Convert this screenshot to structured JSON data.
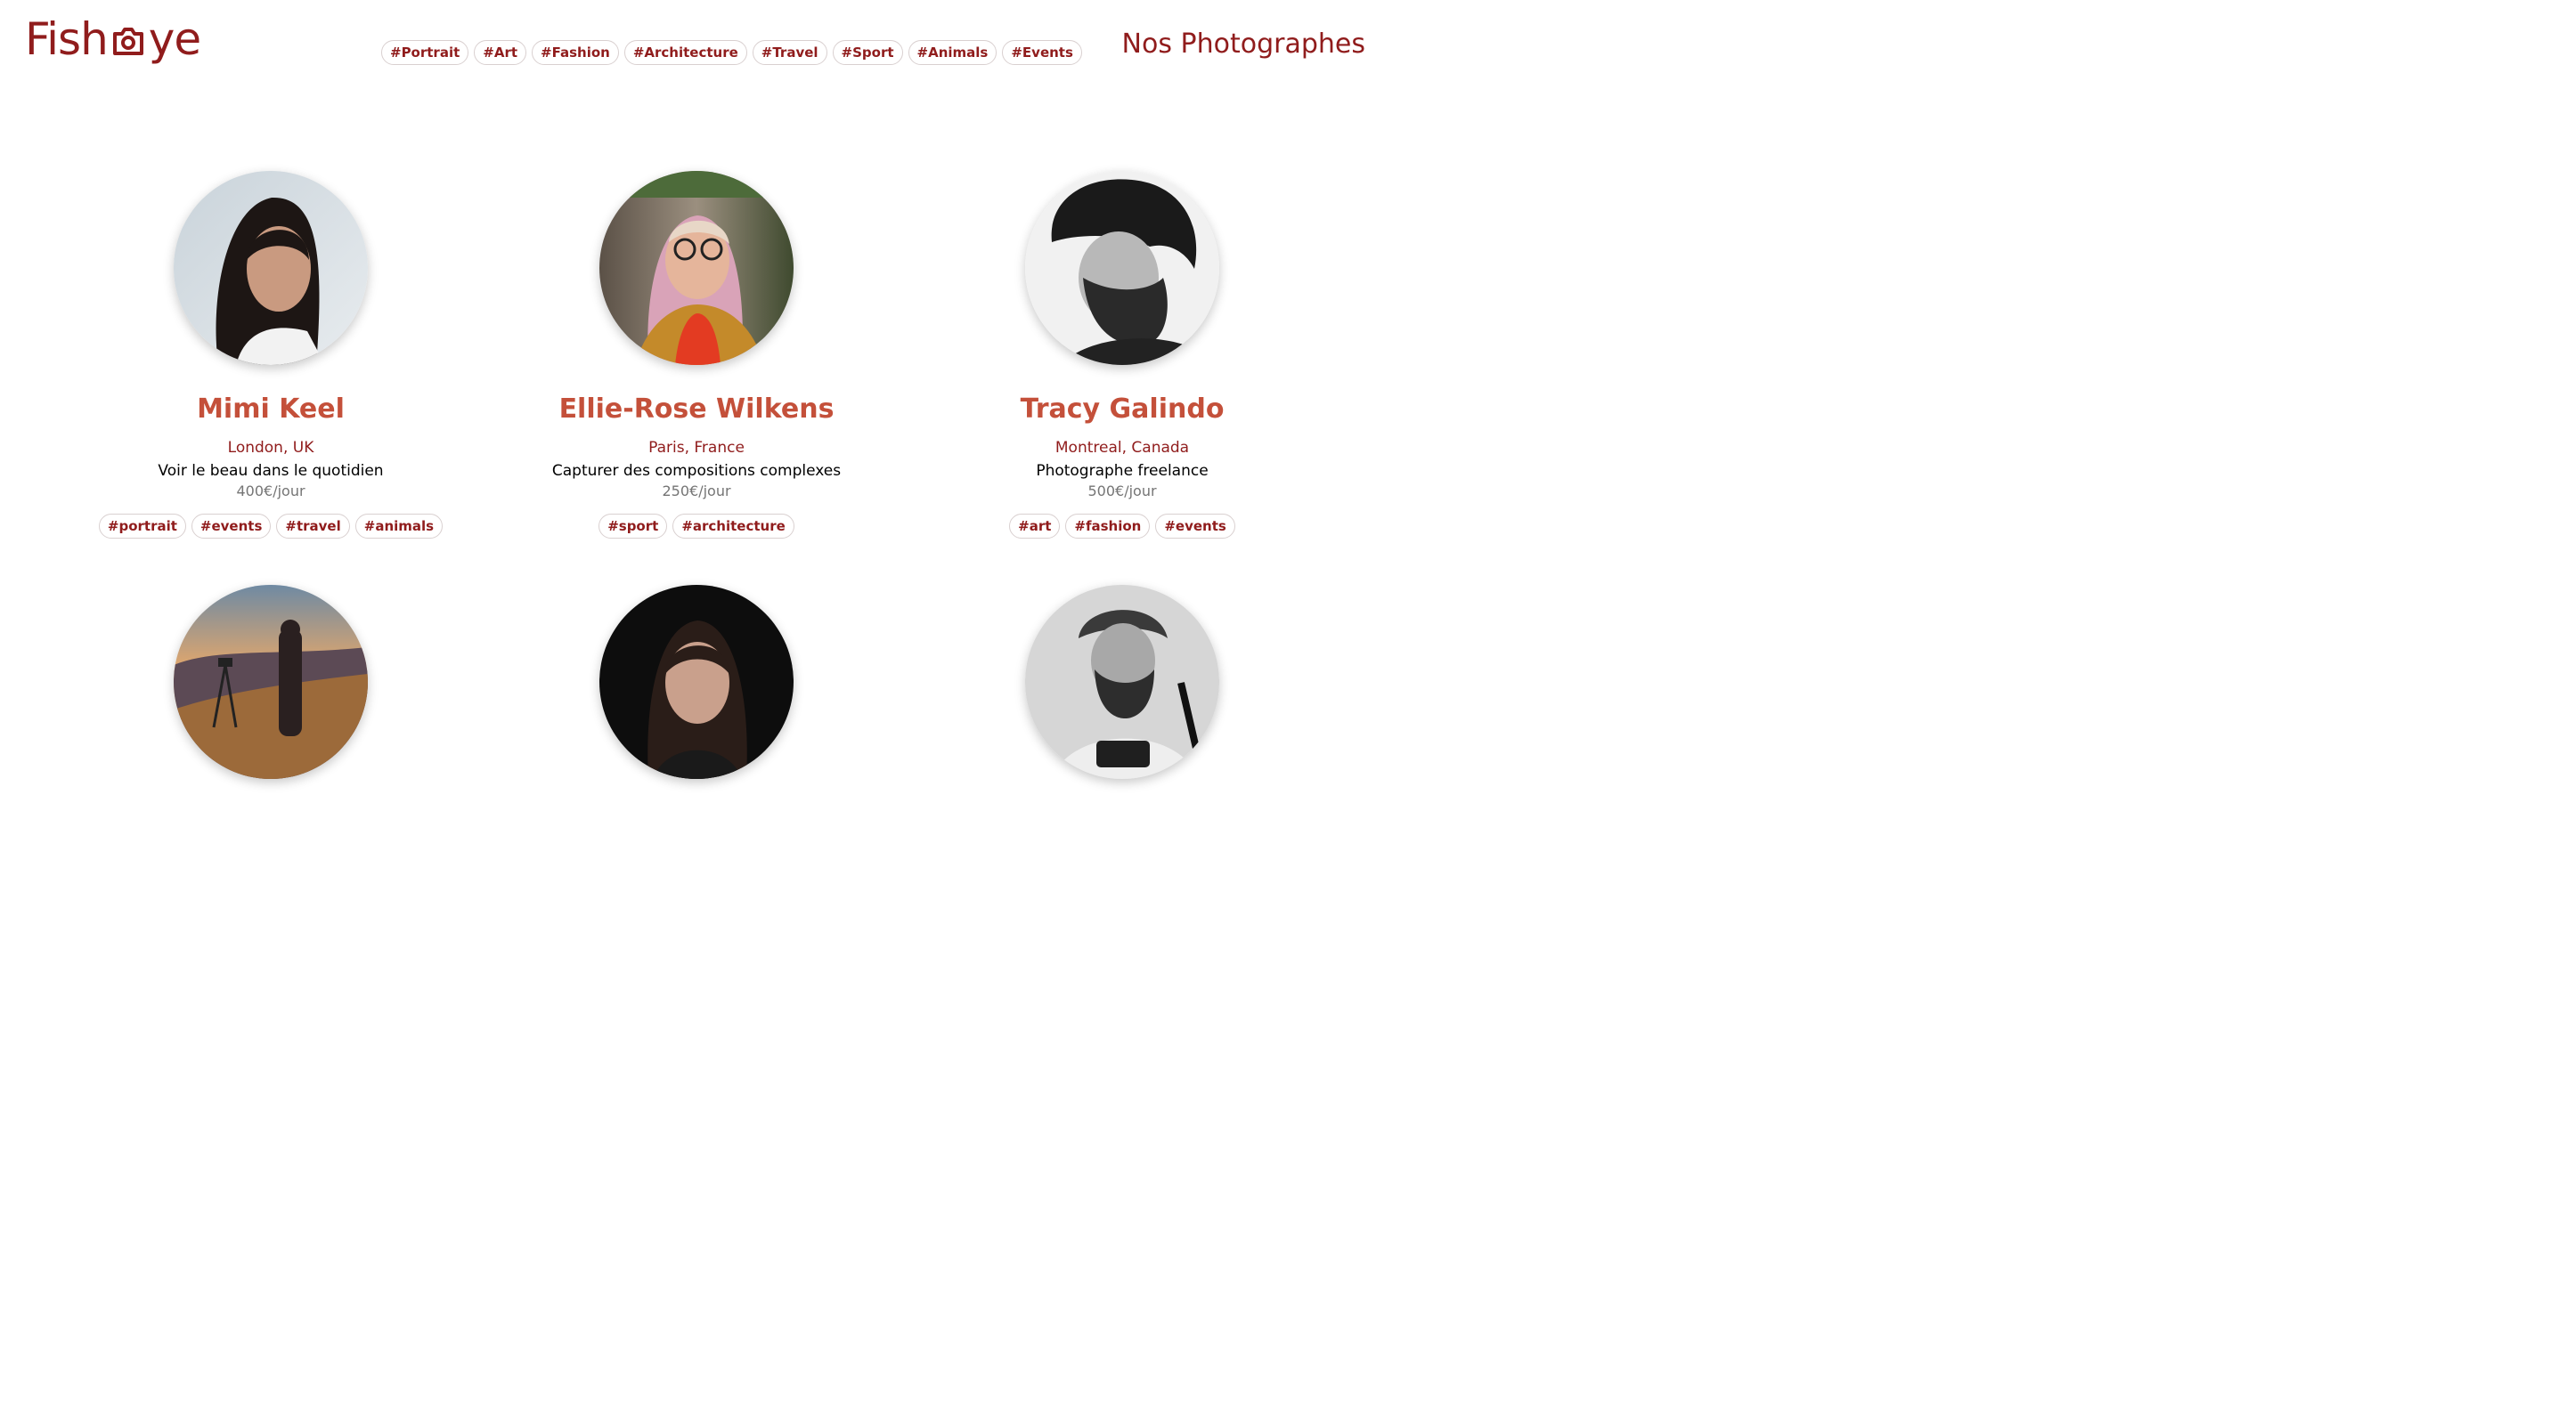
{
  "logo": {
    "text_before": "Fish",
    "text_after": "ye",
    "icon": "camera-icon",
    "color": "#901c1c"
  },
  "nav": {
    "tags": [
      "#Portrait",
      "#Art",
      "#Fashion",
      "#Architecture",
      "#Travel",
      "#Sport",
      "#Animals",
      "#Events"
    ]
  },
  "page_title": "Nos Photographes",
  "colors": {
    "primary": "#901c1c",
    "name": "#c4503a",
    "price": "#757575"
  },
  "photographers": [
    {
      "name": "Mimi Keel",
      "city": "London, UK",
      "tagline": "Voir le beau dans le quotidien",
      "price": "400€/jour",
      "tags": [
        "#portrait",
        "#events",
        "#travel",
        "#animals"
      ],
      "portrait": "portrait-photo"
    },
    {
      "name": "Ellie-Rose Wilkens",
      "city": "Paris, France",
      "tagline": "Capturer des compositions complexes",
      "price": "250€/jour",
      "tags": [
        "#sport",
        "#architecture"
      ],
      "portrait": "portrait-photo"
    },
    {
      "name": "Tracy Galindo",
      "city": "Montreal, Canada",
      "tagline": "Photographe freelance",
      "price": "500€/jour",
      "tags": [
        "#art",
        "#fashion",
        "#events"
      ],
      "portrait": "portrait-photo"
    },
    {
      "portrait": "portrait-photo"
    },
    {
      "portrait": "portrait-photo"
    },
    {
      "portrait": "portrait-photo"
    }
  ]
}
